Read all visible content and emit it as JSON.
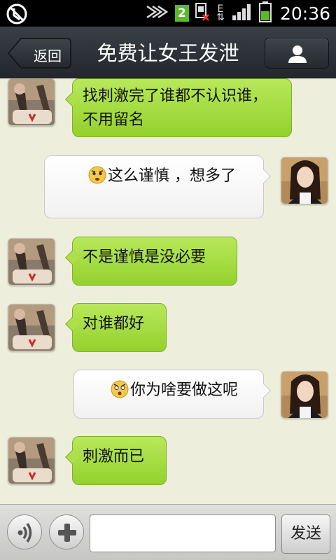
{
  "status_bar": {
    "time": "20:36",
    "sim_badge": "2",
    "network_type": "E",
    "icons": [
      "no-disturb-icon",
      "signal-strength-icon",
      "sim-card-2-icon",
      "sim-no-service-icon",
      "data-e-icon",
      "cell-signal-icon",
      "battery-icon"
    ]
  },
  "header": {
    "back_label": "返回",
    "title": "免费让女王发泄",
    "profile_icon": "person-icon"
  },
  "messages": [
    {
      "side": "received",
      "text": "找刺激完了谁都不认识谁，不用留名"
    },
    {
      "side": "sent",
      "emoji": "worried-face",
      "text": "这么谨慎  ，想多了"
    },
    {
      "side": "received",
      "text": "不是谨慎是没必要"
    },
    {
      "side": "received",
      "text": "对谁都好"
    },
    {
      "side": "sent",
      "emoji": "surprised-face",
      "text": "你为啥要做这呢"
    },
    {
      "side": "received",
      "text": "刺激而已"
    }
  ],
  "input_bar": {
    "voice_icon": "voice-icon",
    "plus_icon": "plus-icon",
    "message_value": "",
    "send_label": "发送"
  },
  "colors": {
    "received_bubble": "#9fd637",
    "sent_bubble": "#ffffff",
    "chat_background": "#eeeedd",
    "header_background": "#2e3339"
  }
}
